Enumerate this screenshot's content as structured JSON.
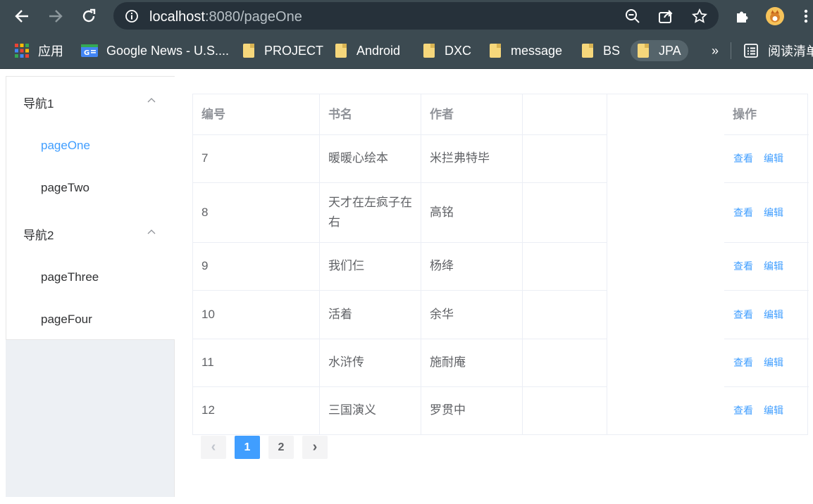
{
  "browser": {
    "url_host": "localhost",
    "url_port_path": ":8080/pageOne",
    "bookmarks": [
      {
        "label": "应用",
        "icon": "apps-grid-icon"
      },
      {
        "label": "Google News - U.S....",
        "icon": "google-news-icon"
      },
      {
        "label": "PROJECT",
        "icon": "folder-icon"
      },
      {
        "label": "Android",
        "icon": "folder-icon"
      },
      {
        "label": "DXC",
        "icon": "folder-icon"
      },
      {
        "label": "message",
        "icon": "folder-icon"
      },
      {
        "label": "BS",
        "icon": "folder-icon"
      },
      {
        "label": "JPA",
        "icon": "folder-icon"
      }
    ],
    "overflow": "»",
    "reading_list": "阅读清单"
  },
  "sidebar": {
    "groups": [
      {
        "title": "导航1",
        "items": [
          "pageOne",
          "pageTwo"
        ]
      },
      {
        "title": "导航2",
        "items": [
          "pageThree",
          "pageFour"
        ]
      }
    ],
    "active_item": "pageOne"
  },
  "table": {
    "headers": [
      "编号",
      "书名",
      "作者",
      "",
      "",
      "操作"
    ],
    "rows": [
      {
        "id": "7",
        "name": "暖暖心绘本",
        "author": "米拦弗特毕"
      },
      {
        "id": "8",
        "name": "天才在左疯子在右",
        "author": "高铭"
      },
      {
        "id": "9",
        "name": "我们仨",
        "author": "杨绛"
      },
      {
        "id": "10",
        "name": "活着",
        "author": "余华"
      },
      {
        "id": "11",
        "name": "水浒传",
        "author": "施耐庵"
      },
      {
        "id": "12",
        "name": "三国演义",
        "author": "罗贯中"
      }
    ],
    "actions": {
      "view": "查看",
      "edit": "编辑"
    }
  },
  "pagination": {
    "prev": "‹",
    "pages": [
      "1",
      "2"
    ],
    "current": "1",
    "next": "›"
  },
  "colors": {
    "accent": "#409eff",
    "chrome": "#3c4a51"
  }
}
